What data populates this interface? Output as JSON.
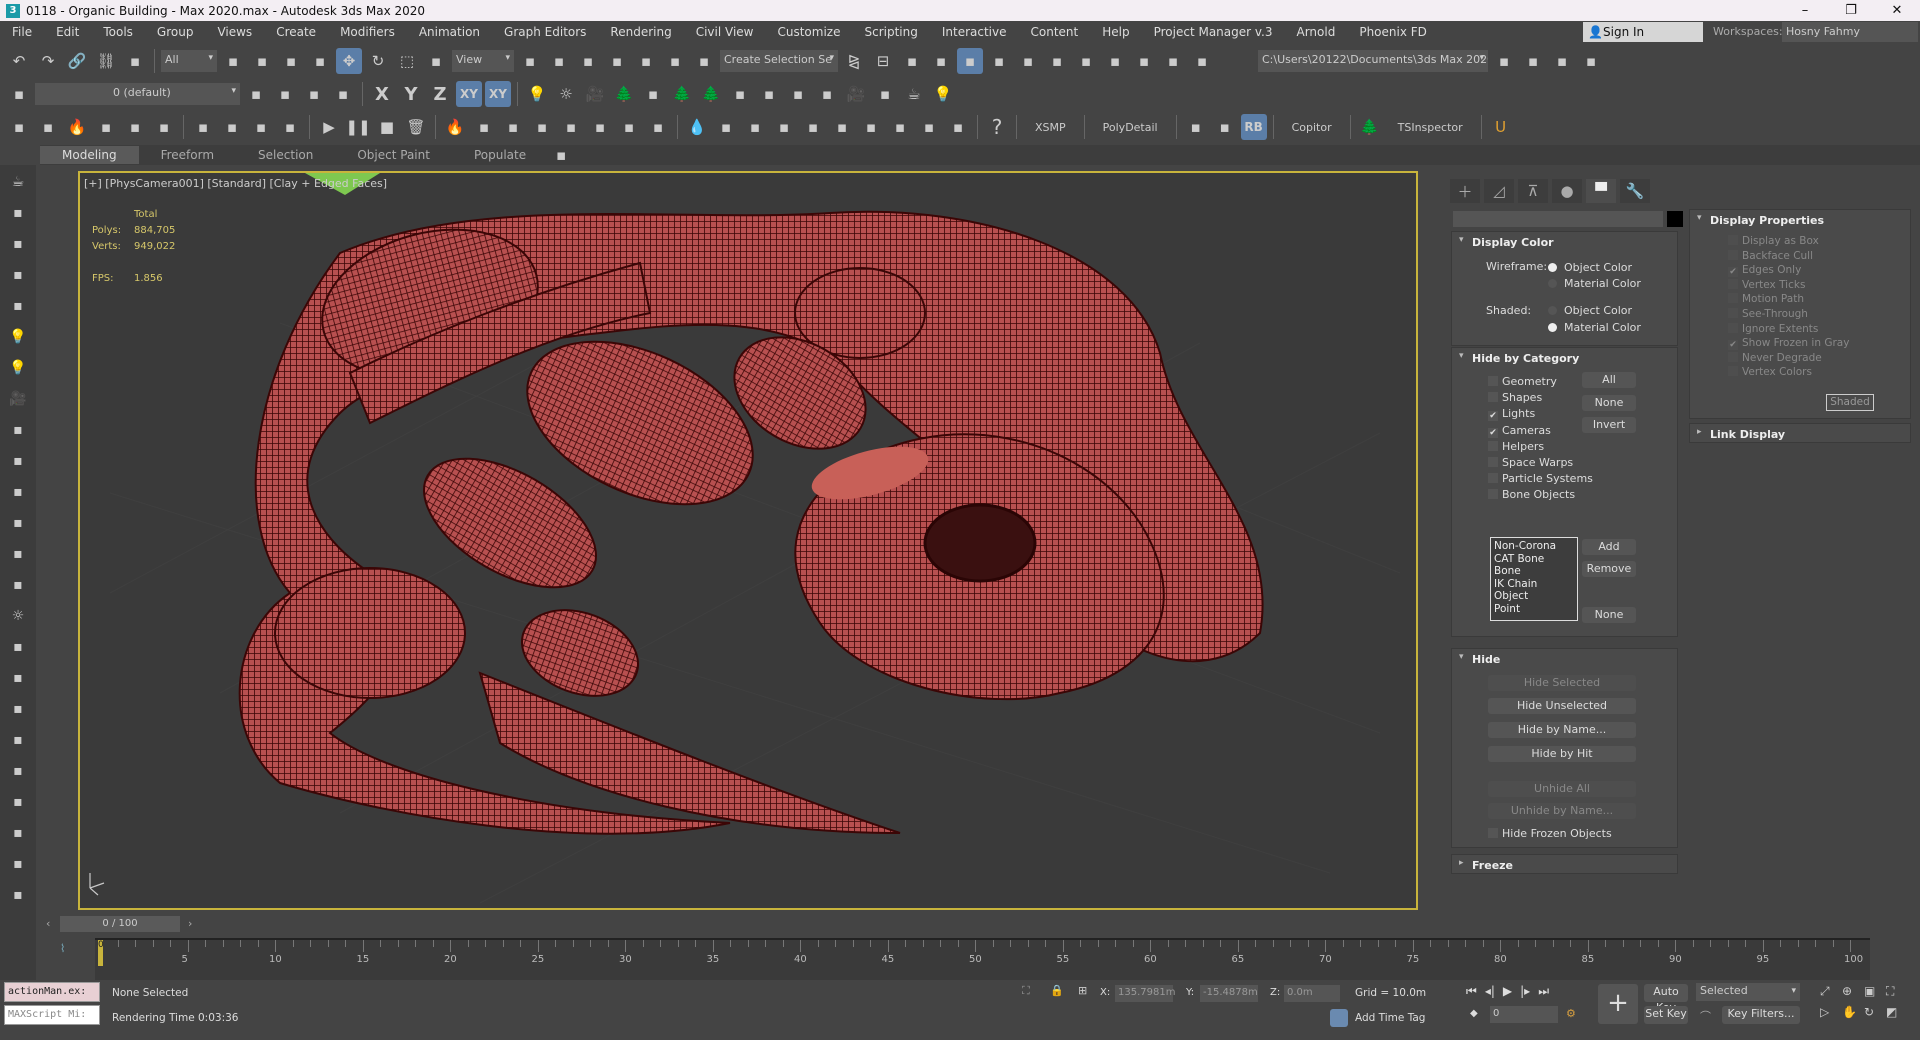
{
  "window": {
    "title": "0118 - Organic Building - Max 2020.max - Autodesk 3ds Max 2020",
    "logo": "3",
    "minimize": "–",
    "maximize": "❐",
    "close": "✕"
  },
  "menu": [
    "File",
    "Edit",
    "Tools",
    "Group",
    "Views",
    "Create",
    "Modifiers",
    "Animation",
    "Graph Editors",
    "Rendering",
    "Civil View",
    "Customize",
    "Scripting",
    "Interactive",
    "Content",
    "Help",
    "Project Manager v.3",
    "Arnold",
    "Phoenix FD"
  ],
  "account": {
    "sign_in": "Sign In",
    "workspaces_label": "Workspaces:",
    "workspace": "Hosny Fahmy"
  },
  "toolbar1": {
    "filter": "All",
    "ref_coord": "View",
    "selection_set": "Create Selection Se",
    "project_path": "C:\\Users\\20122\\Documents\\3ds Max 2020",
    "icons_a": [
      "undo-icon",
      "redo-icon",
      "link-icon",
      "unlink-icon",
      "bind-spacewarp-icon"
    ],
    "icons_b": [
      "select-object-icon",
      "select-by-name-icon",
      "rect-selection-icon",
      "window-crossing-icon",
      "move-icon",
      "rotate-icon",
      "scale-icon",
      "placement-icon"
    ],
    "icons_c": [
      "use-pivot-icon",
      "keyboard-shortcut-icon",
      "snap-3d-icon",
      "angle-snap-icon",
      "percent-snap-icon",
      "spinner-snap-icon",
      "edit-named-sets-icon"
    ],
    "icons_d": [
      "mirror-icon",
      "align-icon",
      "scene-explorer-icon",
      "layer-explorer-icon",
      "ribbon-toggle-icon",
      "curve-editor-icon",
      "dope-sheet-icon",
      "material-editor-icon",
      "render-setup-icon",
      "rendered-frame-icon",
      "render-production-icon",
      "render-cloud-icon",
      "render-grid-icon"
    ],
    "icons_e": [
      "project-folder-icon",
      "open-project-icon",
      "create-project-icon",
      "project-settings-icon"
    ]
  },
  "toolbar2": {
    "layer": "0 (default)",
    "axes": [
      "X",
      "Y",
      "Z",
      "XY",
      "XY"
    ],
    "icons": [
      "light-icon",
      "sun-icon",
      "camera-icon",
      "tree-icon",
      "list-icon",
      "pine-icon",
      "tree-dark-icon",
      "gear-ring-icon",
      "display-icon",
      "viewport-icon",
      "frame-icon",
      "camera-group-icon",
      "screen-icon",
      "teapot-icon",
      "bulb-icon"
    ]
  },
  "toolbar3": {
    "labels": [
      "XSMP",
      "PolyDetail",
      "Copitor",
      "TSInspector"
    ],
    "rb": "RB",
    "help": "?",
    "icons": [
      "box-red-icon",
      "box-blue-icon",
      "fire-red-icon",
      "drop-blue-icon",
      "atom-yellow-icon",
      "cube-purple-icon",
      "network-icon",
      "arrow-green-icon",
      "checker-icon",
      "burst-icon",
      "play-icon",
      "pause-icon",
      "stop-icon",
      "trash-icon",
      "fire-icon",
      "fire2-icon",
      "explosion-icon",
      "explosion2-icon",
      "smoke-icon",
      "smoke2-icon",
      "candle-icon",
      "steam-icon",
      "water-icon",
      "milk-icon",
      "beer-icon",
      "coffee-icon",
      "liquid-icon",
      "splash-red-icon",
      "bottle-icon",
      "vortex-icon",
      "waterfall-icon",
      "ocean-icon"
    ]
  },
  "ribbon": {
    "tabs": [
      "Modeling",
      "Freeform",
      "Selection",
      "Object Paint",
      "Populate"
    ],
    "active": "Modeling"
  },
  "viewport": {
    "label": "[+] [PhysCamera001] [Standard] [Clay + Edged Faces]",
    "stats": {
      "header": "Total",
      "polys_label": "Polys:",
      "polys": "884,705",
      "verts_label": "Verts:",
      "verts": "949,022",
      "fps_label": "FPS:",
      "fps": "1.856"
    },
    "model_color": "#b85050",
    "wire_color": "#3b0606"
  },
  "command_panel": {
    "tabs": [
      "create-tab",
      "modify-tab",
      "hierarchy-tab",
      "motion-tab",
      "display-tab",
      "utilities-tab"
    ],
    "display_color": {
      "title": "Display Color",
      "wireframe_label": "Wireframe:",
      "shaded_label": "Shaded:",
      "object_color": "Object Color",
      "material_color": "Material Color"
    },
    "hide_by_category": {
      "title": "Hide by Category",
      "items": [
        {
          "label": "Geometry",
          "checked": false
        },
        {
          "label": "Shapes",
          "checked": false
        },
        {
          "label": "Lights",
          "checked": true
        },
        {
          "label": "Cameras",
          "checked": true
        },
        {
          "label": "Helpers",
          "checked": false
        },
        {
          "label": "Space Warps",
          "checked": false
        },
        {
          "label": "Particle Systems",
          "checked": false
        },
        {
          "label": "Bone Objects",
          "checked": false
        }
      ],
      "all": "All",
      "none": "None",
      "invert": "Invert",
      "list": [
        "Non-Corona",
        "CAT Bone",
        "Bone",
        "IK Chain Object",
        "Point"
      ],
      "add": "Add",
      "remove": "Remove",
      "none2": "None"
    },
    "hide": {
      "title": "Hide",
      "hide_selected": "Hide Selected",
      "hide_unselected": "Hide Unselected",
      "hide_by_name": "Hide by Name...",
      "hide_by_hit": "Hide by Hit",
      "unhide_all": "Unhide All",
      "unhide_by_name": "Unhide by Name...",
      "hide_frozen": "Hide Frozen Objects"
    },
    "freeze": {
      "title": "Freeze"
    },
    "display_properties": {
      "title": "Display Properties",
      "items": [
        {
          "label": "Display as Box",
          "checked": false
        },
        {
          "label": "Backface Cull",
          "checked": false
        },
        {
          "label": "Edges Only",
          "checked": true
        },
        {
          "label": "Vertex Ticks",
          "checked": false
        },
        {
          "label": "Motion Path",
          "checked": false
        },
        {
          "label": "See-Through",
          "checked": false
        },
        {
          "label": "Ignore Extents",
          "checked": false
        },
        {
          "label": "Show Frozen in Gray",
          "checked": true
        },
        {
          "label": "Never Degrade",
          "checked": false
        },
        {
          "label": "Vertex Colors",
          "checked": false
        }
      ],
      "shaded": "Shaded"
    },
    "link_display": {
      "title": "Link Display"
    }
  },
  "timeline": {
    "slider": "0 / 100",
    "current": 0,
    "max": 100,
    "step": 5
  },
  "status": {
    "script1": "actionMan.ex:",
    "script2": "MAXScript Mi:",
    "selection": "None Selected",
    "render_time": "Rendering Time  0:03:36",
    "x_label": "X:",
    "x": "135.7981m",
    "y_label": "Y:",
    "y": "-15.4878m",
    "z_label": "Z:",
    "z": "0.0m",
    "grid": "Grid = 10.0m",
    "add_time_tag": "Add Time Tag",
    "auto_key": "Auto Key",
    "set_key": "Set Key",
    "key_mode": "Selected",
    "key_filters": "Key Filters...",
    "frame": "0"
  }
}
